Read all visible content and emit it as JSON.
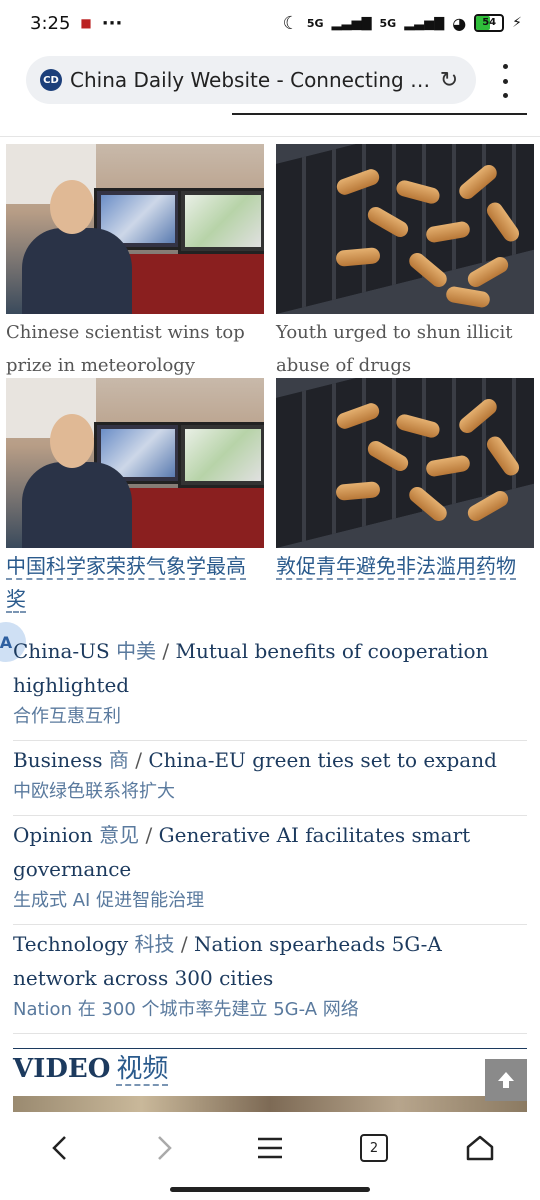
{
  "status_bar": {
    "time": "3:25",
    "dots": "···",
    "network1": "5G",
    "network2": "5G",
    "battery": "54",
    "battery_level": 0.54
  },
  "browser": {
    "site_badge": "CD",
    "page_title": "China Daily Website - Connecting China Connecting the World",
    "tab_count": "2"
  },
  "cards": [
    {
      "caption": "Chinese scientist wins top prize in meteorology",
      "image": "scientist-photo"
    },
    {
      "caption": "Youth urged to shun illicit abuse of drugs",
      "image": "pills-photo"
    },
    {
      "caption": "中国科学家荣获气象学最高奖",
      "image": "scientist-photo"
    },
    {
      "caption": "敦促青年避免非法滥用药物",
      "image": "pills-photo"
    }
  ],
  "news": [
    {
      "category": "China-US",
      "category_zh": "中美",
      "headline": "Mutual benefits of cooperation highlighted",
      "headline_zh": "合作互惠互利"
    },
    {
      "category": "Business",
      "category_zh": "商",
      "headline": "China-EU green ties set to expand",
      "headline_zh": "中欧绿色联系将扩大"
    },
    {
      "category": "Opinion",
      "category_zh": "意见",
      "headline": "Generative AI facilitates smart governance",
      "headline_zh": "生成式 AI 促进智能治理"
    },
    {
      "category": "Technology",
      "category_zh": "科技",
      "headline": "Nation spearheads 5G-A network across 300 cities",
      "headline_zh": "Nation 在 300 个城市率先建立 5G-A 网络"
    }
  ],
  "video": {
    "label": "VIDEO",
    "label_zh": "视频"
  },
  "colors": {
    "link": "#1c3a5e",
    "accent_zh": "#5a7a9e",
    "url_bar": "#eef0f3"
  }
}
